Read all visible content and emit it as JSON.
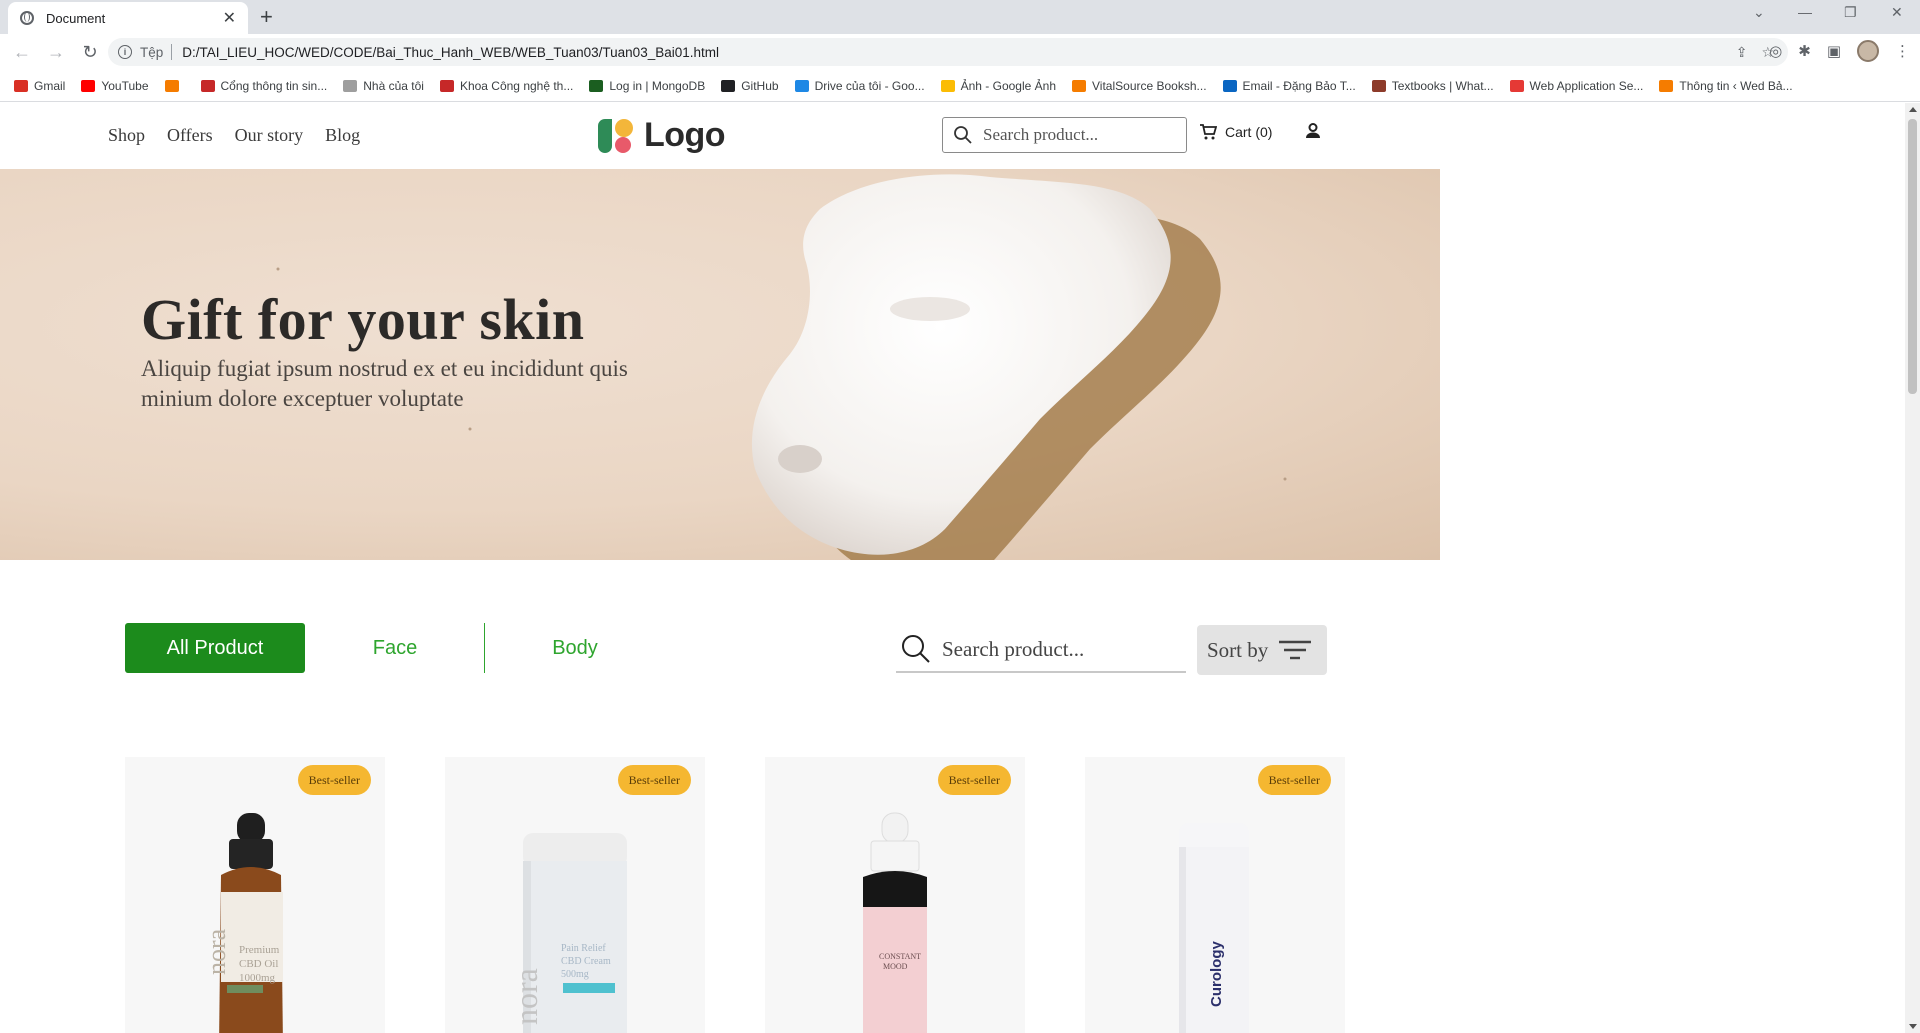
{
  "browser": {
    "tab_title": "Document",
    "address_scheme": "Tệp",
    "address_url": "D:/TAI_LIEU_HOC/WED/CODE/Bai_Thuc_Hanh_WEB/WEB_Tuan03/Tuan03_Bai01.html",
    "bookmarks": [
      {
        "label": "Gmail",
        "color": "#d93025"
      },
      {
        "label": "YouTube",
        "color": "#ff0000"
      },
      {
        "label": "",
        "color": "#f57c00"
      },
      {
        "label": "Cổng thông tin sin...",
        "color": "#c62828"
      },
      {
        "label": "Nhà của tôi",
        "color": "#9e9e9e"
      },
      {
        "label": "Khoa Công nghệ th...",
        "color": "#c62828"
      },
      {
        "label": "Log in | MongoDB",
        "color": "#1b5e20"
      },
      {
        "label": "GitHub",
        "color": "#202124"
      },
      {
        "label": "Drive của tôi - Goo...",
        "color": "#1e88e5"
      },
      {
        "label": "Ảnh - Google Ảnh",
        "color": "#fbbc04"
      },
      {
        "label": "VitalSource Booksh...",
        "color": "#f57c00"
      },
      {
        "label": "Email - Đặng Bảo T...",
        "color": "#0a66c2"
      },
      {
        "label": "Textbooks | What...",
        "color": "#8d3b2a"
      },
      {
        "label": "Web Application Se...",
        "color": "#e53935"
      },
      {
        "label": "Thông tin ‹ Wed Bả...",
        "color": "#f57c00"
      }
    ]
  },
  "site": {
    "nav": [
      "Shop",
      "Offers",
      "Our story",
      "Blog"
    ],
    "logo_text": "Logo",
    "search_placeholder": "Search product...",
    "cart_label": "Cart (0)"
  },
  "hero": {
    "title": "Gift for your skin",
    "subtitle": "Aliquip fugiat ipsum nostrud ex et eu incididunt quis minium dolore exceptuer voluptate"
  },
  "filters": {
    "all_label": "All Product",
    "face_label": "Face",
    "body_label": "Body",
    "search_placeholder": "Search product...",
    "sort_label": "Sort by",
    "active_color": "#1c8b1c",
    "text_color": "#2ea52e"
  },
  "products": [
    {
      "badge": "Best-seller",
      "label_lines": [
        "Premium",
        "CBD Oil",
        "1000mg"
      ],
      "brand": "nora"
    },
    {
      "badge": "Best-seller",
      "label_lines": [
        "Pain Relief",
        "CBD Cream",
        "500mg"
      ],
      "brand": "nora"
    },
    {
      "badge": "Best-seller",
      "label_lines": [
        "CONSTANT",
        "MOOD"
      ],
      "brand": ""
    },
    {
      "badge": "Best-seller",
      "label_lines": [
        "Curology"
      ],
      "brand": ""
    }
  ]
}
